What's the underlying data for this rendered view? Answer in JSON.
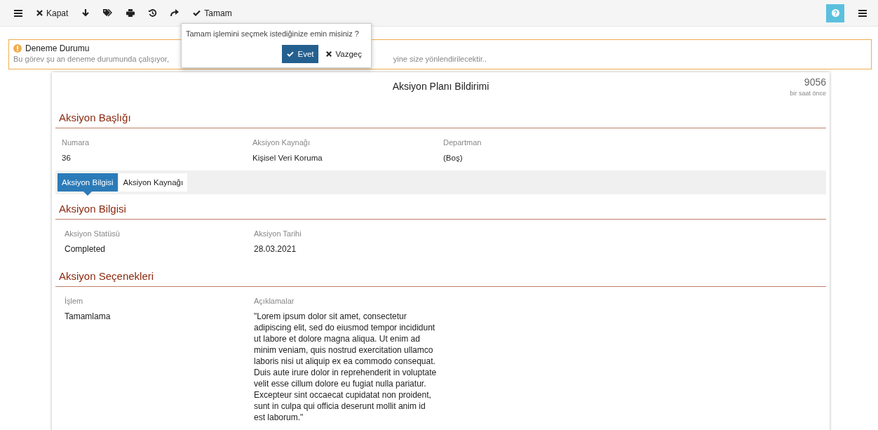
{
  "toolbar": {
    "items": [
      {
        "kind": "menu"
      },
      {
        "kind": "close",
        "label": "Kapat"
      },
      {
        "kind": "down"
      },
      {
        "kind": "tags"
      },
      {
        "kind": "print"
      },
      {
        "kind": "history"
      },
      {
        "kind": "forward"
      },
      {
        "kind": "check",
        "label": "Tamam"
      }
    ],
    "right": [
      {
        "kind": "help"
      },
      {
        "kind": "menu"
      }
    ]
  },
  "popover": {
    "message": "Tamam işlemini seçmek istediğinize emin misiniz ?",
    "confirm": "Evet",
    "cancel": "Vazgeç"
  },
  "notice": {
    "title": "Deneme Durumu",
    "text_start": "Bu görev şu an deneme durumunda çalışıyor,",
    "text_end": "yine size yönlendirilecektir.."
  },
  "form": {
    "title": "Aksiyon Planı Bildirimi",
    "number": "9056",
    "time": "bir saat önce",
    "header_section": {
      "title": "Aksiyon Başlığı",
      "fields": [
        {
          "label": "Numara",
          "value": "36"
        },
        {
          "label": "Aksiyon Kaynağı",
          "value": "Kişisel Veri Koruma"
        },
        {
          "label": "Departman",
          "value": "(Boş)"
        }
      ]
    },
    "tabs": [
      {
        "label": "Aksiyon Bilgisi",
        "selected": true
      },
      {
        "label": "Aksiyon Kaynağı",
        "selected": false
      }
    ],
    "sections": [
      {
        "title": "Aksiyon Bilgisi",
        "fields": [
          {
            "label": "Aksiyon Statüsü",
            "value": "Completed"
          },
          {
            "label": "Aksiyon Tarihi",
            "value": "28.03.2021"
          }
        ]
      },
      {
        "title": "Aksiyon Seçenekleri",
        "fields": [
          {
            "label": "İşlem",
            "value": "Tamamlama"
          },
          {
            "label": "Açıklamalar",
            "value": "\"Lorem ipsum dolor sit amet, consectetur adipiscing elit, sed do eiusmod tempor incididunt ut labore et dolore magna aliqua. Ut enim ad minim veniam, quis nostrud exercitation ullamco laboris nisi ut aliquip ex ea commodo consequat. Duis aute irure dolor in reprehenderit in voluptate velit esse cillum dolore eu fugiat nulla pariatur. Excepteur sint occaecat cupidatat non proident, sunt in culpa qui officia deserunt mollit anim id est laborum.\""
          }
        ]
      }
    ]
  }
}
